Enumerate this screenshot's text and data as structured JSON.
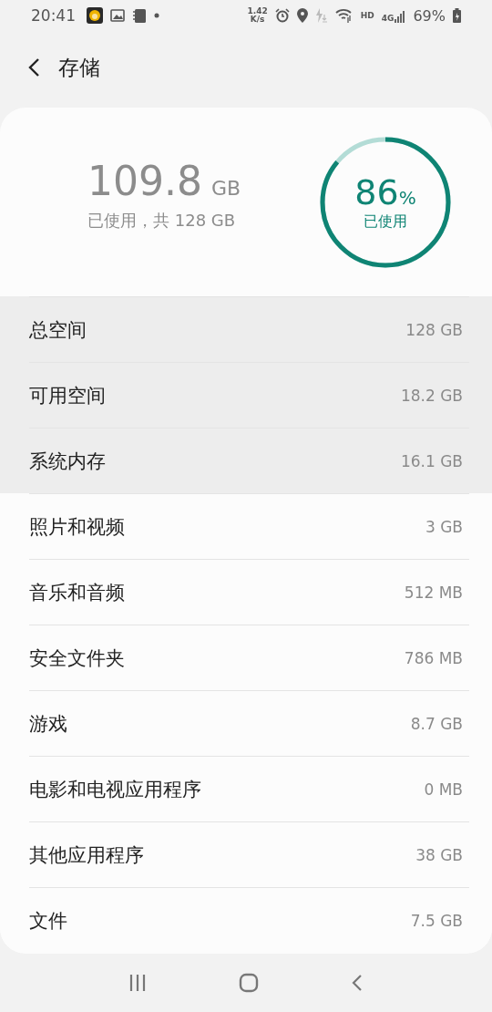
{
  "status_bar": {
    "time": "20:41",
    "speed_value": "1.42",
    "speed_unit": "K/s",
    "hd": "HD",
    "network": "4G",
    "battery": "69%"
  },
  "header": {
    "title": "存储"
  },
  "summary": {
    "used_value": "109.8",
    "used_unit": "GB",
    "caption": "已使用，共 128 GB",
    "ring": {
      "percent": "86",
      "percent_sign": "%",
      "label": "已使用",
      "level": 0.86
    }
  },
  "rows": [
    {
      "label": "总空间",
      "value": "128 GB",
      "highlighted": true
    },
    {
      "label": "可用空间",
      "value": "18.2 GB",
      "highlighted": true
    },
    {
      "label": "系统内存",
      "value": "16.1 GB",
      "highlighted": true
    },
    {
      "label": "照片和视频",
      "value": "3 GB",
      "highlighted": false
    },
    {
      "label": "音乐和音频",
      "value": "512 MB",
      "highlighted": false
    },
    {
      "label": "安全文件夹",
      "value": "786 MB",
      "highlighted": false
    },
    {
      "label": "游戏",
      "value": "8.7 GB",
      "highlighted": false
    },
    {
      "label": "电影和电视应用程序",
      "value": "0 MB",
      "highlighted": false
    },
    {
      "label": "其他应用程序",
      "value": "38 GB",
      "highlighted": false
    },
    {
      "label": "文件",
      "value": "7.5 GB",
      "highlighted": false
    }
  ]
}
